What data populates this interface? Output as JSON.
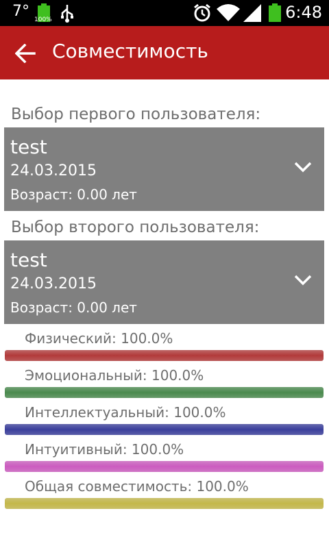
{
  "status": {
    "temperature": "7°",
    "time": "6:48",
    "battery_pct_label": "100%"
  },
  "header": {
    "title": "Совместимость"
  },
  "first_user": {
    "label": "Выбор первого пользователя:",
    "name": "test",
    "date": "24.03.2015",
    "age": "Возраст: 0.00 лет"
  },
  "second_user": {
    "label": "Выбор второго пользователя:",
    "name": "test",
    "date": "24.03.2015",
    "age": "Возраст: 0.00 лет"
  },
  "bars": [
    {
      "label": "Физический: 100.0%",
      "value": 1.0,
      "color": "#b23a3a"
    },
    {
      "label": "Эмоциональный: 100.0%",
      "value": 1.0,
      "color": "#4a8a4e"
    },
    {
      "label": "Интеллектуальный: 100.0%",
      "value": 1.0,
      "color": "#3b3f9c"
    },
    {
      "label": "Интуитивный: 100.0%",
      "value": 1.0,
      "color": "#cc5cc0"
    },
    {
      "label": "Общая совместимость: 100.0%",
      "value": 1.0,
      "color": "#c4b84a"
    }
  ]
}
